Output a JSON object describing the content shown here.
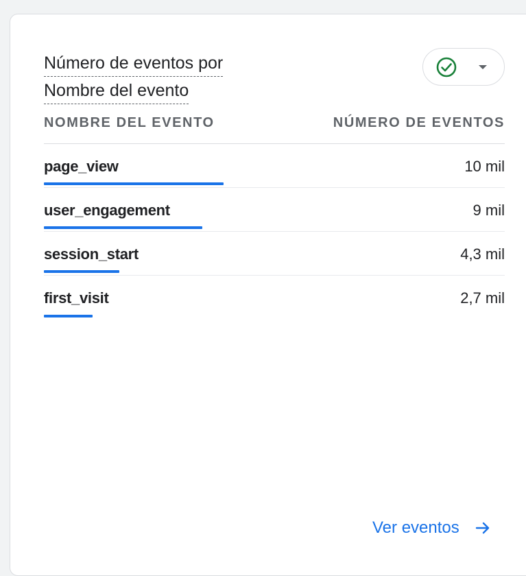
{
  "card": {
    "title_line1": "Número de eventos por",
    "title_line2": "Nombre del evento",
    "filter_icon": "check-circle-icon",
    "filter_caret": "caret-down-icon"
  },
  "table": {
    "headers": [
      "NOMBRE DEL EVENTO",
      "NÚMERO DE EVENTOS"
    ],
    "rows": [
      {
        "name": "page_view",
        "value": "10 mil",
        "fraction": 1.0
      },
      {
        "name": "user_engagement",
        "value": "9 mil",
        "fraction": 0.88
      },
      {
        "name": "session_start",
        "value": "4,3 mil",
        "fraction": 0.42
      },
      {
        "name": "first_visit",
        "value": "2,7 mil",
        "fraction": 0.27
      }
    ]
  },
  "footer": {
    "link_label": "Ver eventos",
    "link_icon": "arrow-right-icon"
  },
  "colors": {
    "accent": "#1a73e8",
    "check": "#188038",
    "text": "#202124",
    "muted": "#5f6368"
  }
}
